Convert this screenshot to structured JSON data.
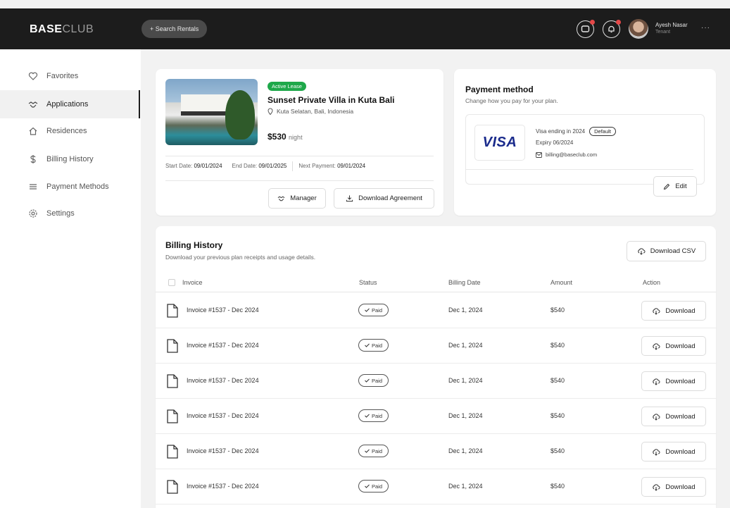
{
  "header": {
    "logo_bold": "BASE",
    "logo_light": "CLUB",
    "search_label": "+ Search Rentals",
    "user_name": "Ayesh Nasar",
    "user_role": "Tenant"
  },
  "sidebar": {
    "items": [
      {
        "label": "Favorites",
        "icon": "heart-icon"
      },
      {
        "label": "Applications",
        "icon": "handshake-icon",
        "active": true
      },
      {
        "label": "Residences",
        "icon": "home-icon"
      },
      {
        "label": "Billing History",
        "icon": "dollar-icon"
      },
      {
        "label": "Payment Methods",
        "icon": "list-icon"
      },
      {
        "label": "Settings",
        "icon": "gear-icon"
      }
    ]
  },
  "property": {
    "badge": "Active Lease",
    "title": "Sunset Private Villa in Kuta Bali",
    "location": "Kuta Selatan, Bali, Indonesia",
    "price": "$530",
    "price_unit": "night",
    "start_label": "Start Date:",
    "start_value": "09/01/2024",
    "end_label": "End Date:",
    "end_value": "09/01/2025",
    "next_label": "Next Payment:",
    "next_value": "09/01/2024",
    "manager_button": "Manager",
    "agreement_button": "Download Agreement"
  },
  "payment": {
    "title": "Payment method",
    "subtitle": "Change how you pay for your plan.",
    "brand": "VISA",
    "card_line1": "Visa ending in 2024",
    "default_label": "Default",
    "card_line2": "Expiry 06/2024",
    "card_email": "billing@baseclub.com",
    "edit_button": "Edit"
  },
  "billing": {
    "title": "Billing History",
    "subtitle": "Download your previous plan receipts and usage details.",
    "csv_button": "Download CSV",
    "columns": [
      "Invoice",
      "Status",
      "Billing Date",
      "Amount",
      "Action"
    ],
    "rows": [
      {
        "invoice": "Invoice #1537 - Dec 2024",
        "status": "Paid",
        "date": "Dec 1, 2024",
        "amount": "$540",
        "action": "Download"
      },
      {
        "invoice": "Invoice #1537 - Dec 2024",
        "status": "Paid",
        "date": "Dec 1, 2024",
        "amount": "$540",
        "action": "Download"
      },
      {
        "invoice": "Invoice #1537 - Dec 2024",
        "status": "Paid",
        "date": "Dec 1, 2024",
        "amount": "$540",
        "action": "Download"
      },
      {
        "invoice": "Invoice #1537 - Dec 2024",
        "status": "Paid",
        "date": "Dec 1, 2024",
        "amount": "$540",
        "action": "Download"
      },
      {
        "invoice": "Invoice #1537 - Dec 2024",
        "status": "Paid",
        "date": "Dec 1, 2024",
        "amount": "$540",
        "action": "Download"
      },
      {
        "invoice": "Invoice #1537 - Dec 2024",
        "status": "Paid",
        "date": "Dec 1, 2024",
        "amount": "$540",
        "action": "Download"
      }
    ]
  },
  "colors": {
    "topbar": "#1c1c1c",
    "accent_green": "#1ea84a",
    "notification_red": "#e54848",
    "visa_blue": "#1a2b8c"
  }
}
